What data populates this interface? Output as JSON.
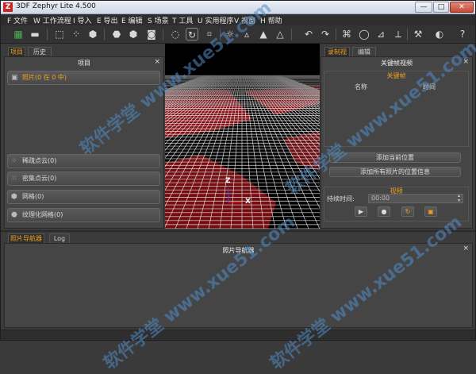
{
  "window": {
    "title": "3DF Zephyr Lite 4.500",
    "app_icon": "Z",
    "controls": [
      "—",
      "□",
      "✕"
    ]
  },
  "menu": [
    "F 文件",
    "W 工作流程",
    "I 导入",
    "E 导出",
    "E 编辑",
    "S 场景",
    "T 工具",
    "U 实用程序",
    "V 视窗",
    "H 帮助"
  ],
  "left": {
    "tabs": [
      "项目",
      "历史"
    ],
    "panel_title": "项目",
    "items": [
      "照片(0 在 0 中)",
      "稀疏点云(0)",
      "密集点云(0)",
      "网格(0)",
      "纹理化网格(0)"
    ]
  },
  "viewport": {
    "axis_z": "Z",
    "axis_x": "X"
  },
  "right": {
    "tabs": [
      "录制视频",
      "编辑"
    ],
    "panel_title": "关键帧视频",
    "keyframe_label": "关键帧",
    "col_name": "名称",
    "col_time": "时间",
    "add_current": "添加当前位置",
    "add_all": "添加所有照片的位置信息",
    "video_label": "视频",
    "duration_label": "持续时间:",
    "duration_value": "00:00"
  },
  "bottom": {
    "tabs": [
      "照片导航器",
      "Log"
    ],
    "panel_title": "照片导航器"
  },
  "watermark": "软件学堂 www.xue51.com",
  "colors": {
    "accent": "#f0a020",
    "bg": "#3b3b3b",
    "grid_red": "#c0141a"
  }
}
